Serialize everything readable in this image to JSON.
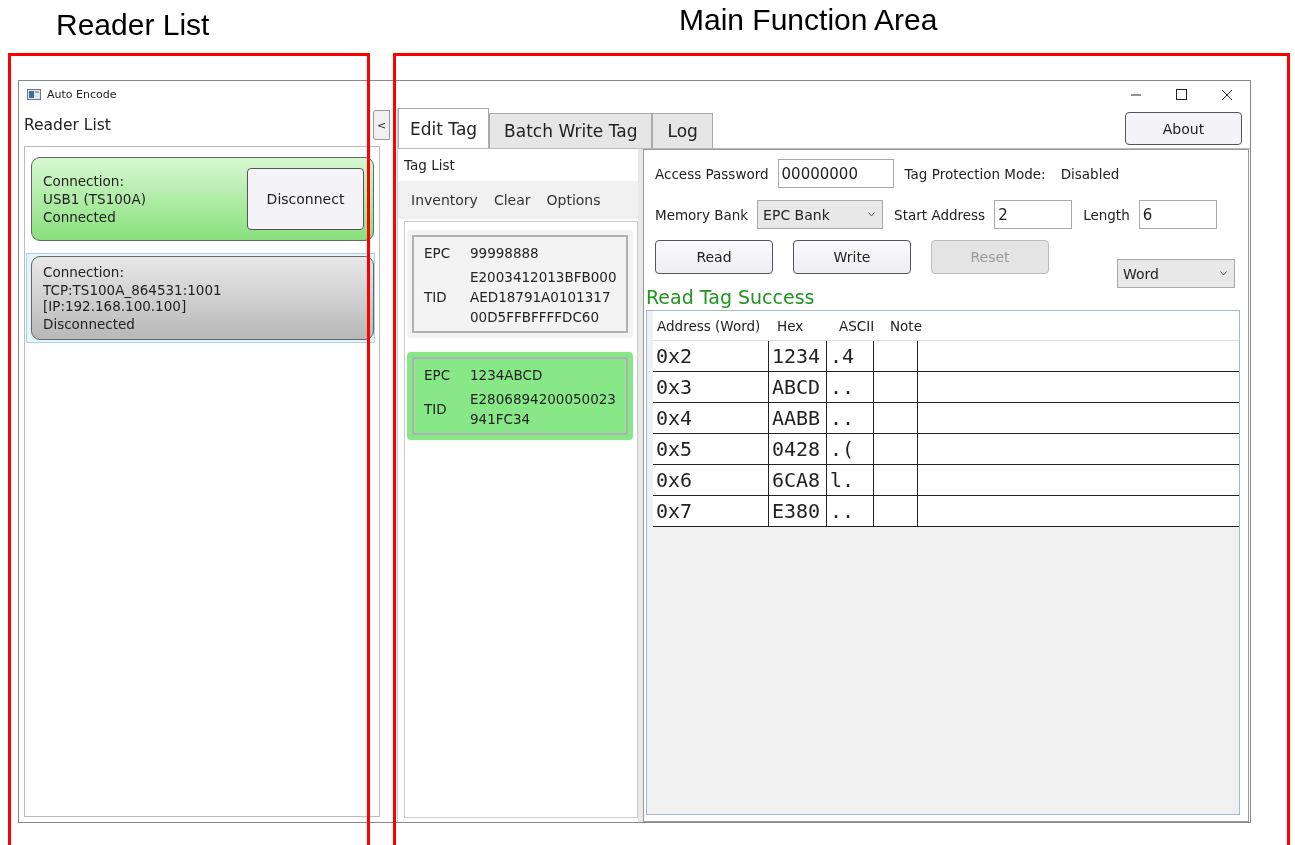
{
  "annotations": [
    {
      "label": "Reader List"
    },
    {
      "label": "Main Function Area"
    }
  ],
  "window": {
    "title": "Auto Encode"
  },
  "reader_panel": {
    "title": "Reader List",
    "collapse_button": "<",
    "readers": [
      {
        "connection_label": "Connection:",
        "connection": "USB1 (TS100A)",
        "status": "Connected",
        "connected": true,
        "selected": false,
        "button": "Disconnect"
      },
      {
        "connection_label": "Connection:",
        "connection": "TCP:TS100A_864531:1001 [IP:192.168.100.100]",
        "status": "Disconnected",
        "connected": false,
        "selected": true
      }
    ]
  },
  "tabs": [
    {
      "label": "Edit Tag",
      "selected": true
    },
    {
      "label": "Batch Write Tag",
      "selected": false
    },
    {
      "label": "Log",
      "selected": false
    }
  ],
  "about_button": "About",
  "tag_list": {
    "title": "Tag List",
    "toolbar": [
      "Inventory",
      "Clear",
      "Options"
    ],
    "tags": [
      {
        "epc_label": "EPC",
        "epc": "99998888",
        "tid_label": "TID",
        "tid_lines": [
          "E2003412013BFB000",
          "AED18791A0101317",
          "00D5FFBFFFFDC60"
        ],
        "selected": false
      },
      {
        "epc_label": "EPC",
        "epc": "1234ABCD",
        "tid_label": "TID",
        "tid_lines": [
          "E2806894200050023",
          "941FC34"
        ],
        "selected": true
      }
    ]
  },
  "form": {
    "access_password_label": "Access Password",
    "access_password": "00000000",
    "protection_mode_label": "Tag Protection Mode:",
    "protection_mode": "Disabled",
    "memory_bank_label": "Memory Bank",
    "memory_bank": "EPC Bank",
    "start_address_label": "Start Address",
    "start_address": "2",
    "length_label": "Length",
    "length": "6",
    "buttons": [
      {
        "label": "Read",
        "disabled": false
      },
      {
        "label": "Write",
        "disabled": false
      },
      {
        "label": "Reset",
        "disabled": true
      }
    ],
    "unit": "Word"
  },
  "status_message": "Read Tag Success",
  "table": {
    "columns": [
      "Address (Word)",
      "Hex",
      "ASCII",
      "Note"
    ],
    "rows": [
      {
        "address": "0x2",
        "hex": "1234",
        "ascii": ".4"
      },
      {
        "address": "0x3",
        "hex": "ABCD",
        "ascii": ".."
      },
      {
        "address": "0x4",
        "hex": "AABB",
        "ascii": ".."
      },
      {
        "address": "0x5",
        "hex": "0428",
        "ascii": ".("
      },
      {
        "address": "0x6",
        "hex": "6CA8",
        "ascii": "l."
      },
      {
        "address": "0x7",
        "hex": "E380",
        "ascii": ".."
      }
    ]
  }
}
